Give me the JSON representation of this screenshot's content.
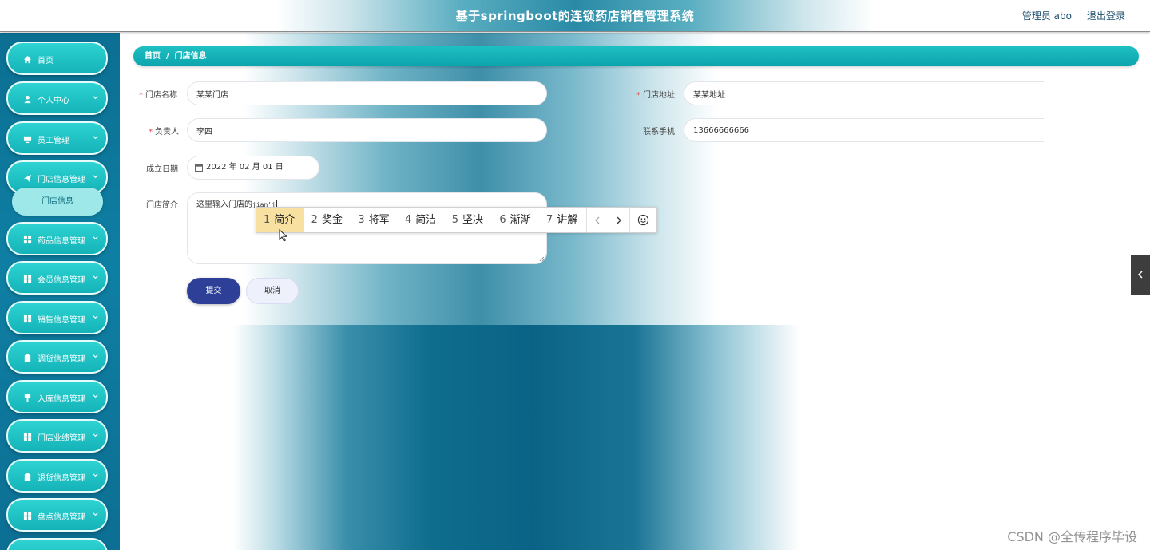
{
  "header": {
    "title": "基于springboot的连锁药店销售管理系统",
    "user_label": "管理员 abo",
    "logout_label": "退出登录"
  },
  "sidebar": {
    "items": [
      {
        "label": "首页",
        "icon": "home-icon",
        "has_arrow": false
      },
      {
        "label": "个人中心",
        "icon": "user-icon",
        "has_arrow": true
      },
      {
        "label": "员工管理",
        "icon": "monitor-icon",
        "has_arrow": true
      },
      {
        "label": "门店信息管理",
        "icon": "send-icon",
        "has_arrow": true
      },
      {
        "label": "药品信息管理",
        "icon": "grid-icon",
        "has_arrow": true
      },
      {
        "label": "会员信息管理",
        "icon": "grid-icon",
        "has_arrow": true
      },
      {
        "label": "销售信息管理",
        "icon": "grid-icon",
        "has_arrow": true
      },
      {
        "label": "调货信息管理",
        "icon": "clipboard-icon",
        "has_arrow": true
      },
      {
        "label": "入库信息管理",
        "icon": "pin-icon",
        "has_arrow": true
      },
      {
        "label": "门店业绩管理",
        "icon": "grid-icon",
        "has_arrow": true
      },
      {
        "label": "退货信息管理",
        "icon": "clipboard-icon",
        "has_arrow": true
      },
      {
        "label": "盘点信息管理",
        "icon": "grid-icon",
        "has_arrow": true
      }
    ],
    "subitem": "门店信息"
  },
  "breadcrumb": {
    "home": "首页",
    "separator": "/",
    "current": "门店信息"
  },
  "form": {
    "store_name_label": "门店名称",
    "store_name_value": "某某门店",
    "store_address_label": "门店地址",
    "store_address_value": "某某地址",
    "manager_label": "负责人",
    "manager_value": "李四",
    "phone_label": "联系手机",
    "phone_value": "13666666666",
    "date_label": "成立日期",
    "date_value": "2022 年 02 月 01 日",
    "intro_label": "门店简介",
    "intro_text": "这里输入门店的",
    "intro_pinyin": "jian'j",
    "required_mark": "*",
    "submit_label": "提交",
    "cancel_label": "取消"
  },
  "ime": {
    "candidates": [
      {
        "num": "1",
        "text": "简介",
        "active": true
      },
      {
        "num": "2",
        "text": "奖金",
        "active": false
      },
      {
        "num": "3",
        "text": "将军",
        "active": false
      },
      {
        "num": "4",
        "text": "简洁",
        "active": false
      },
      {
        "num": "5",
        "text": "坚决",
        "active": false
      },
      {
        "num": "6",
        "text": "渐渐",
        "active": false
      },
      {
        "num": "7",
        "text": "讲解",
        "active": false
      }
    ]
  },
  "watermark": "CSDN @全传程序毕设",
  "colors": {
    "accent_teal": "#14b3b8",
    "sidebar_bg": "#0b6f92",
    "submit_button": "#2d3f97",
    "ime_active": "#f8e0a0",
    "required": "#e34b4b"
  }
}
